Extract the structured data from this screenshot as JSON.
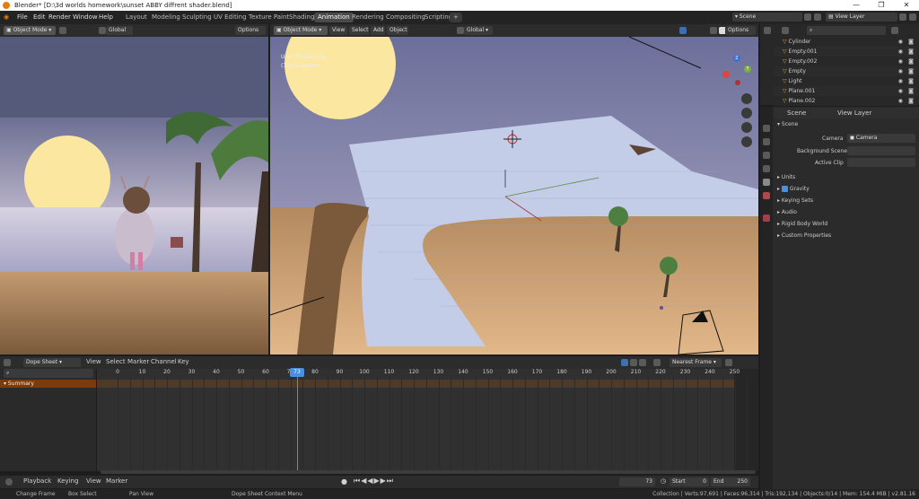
{
  "title": "Blender* [D:\\3d worlds homework\\sunset ABBY diffrent shader.blend]",
  "window_controls": [
    "—",
    "❐",
    "✕"
  ],
  "menu": {
    "file": "File",
    "edit": "Edit",
    "render": "Render",
    "window": "Window",
    "help": "Help"
  },
  "workspaces": [
    "Layout",
    "Modeling",
    "Sculpting",
    "UV Editing",
    "Texture Paint",
    "Shading",
    "Animation",
    "Rendering",
    "Compositing",
    "Scripting",
    "+"
  ],
  "scene": "Scene",
  "view_layer": "View Layer",
  "left_view": {
    "mode": "Object Mode",
    "transform": "Global",
    "options": "Options"
  },
  "main_view": {
    "mode": "Object Mode",
    "view": "View",
    "select": "Select",
    "add": "Add",
    "object": "Object",
    "transform": "Global",
    "options": "Options",
    "info_line1": "User Perspective",
    "info_line2": "(73) Collection"
  },
  "outliner": {
    "items": [
      "Cylinder",
      "Empty.001",
      "Empty.002",
      "Empty",
      "Light",
      "Plane.001",
      "Plane.002"
    ]
  },
  "properties": {
    "scene_tab": "Scene",
    "view_layer_tab": "View Layer",
    "section": "Scene",
    "camera_label": "Camera",
    "camera_value": "Camera",
    "background_label": "Background Scene",
    "clip_label": "Active Clip",
    "panels": [
      "Units",
      "Gravity",
      "Keying Sets",
      "Audio",
      "Rigid Body World",
      "Custom Properties"
    ]
  },
  "dopesheet": {
    "editor": "Dope Sheet",
    "view": "View",
    "select": "Select",
    "marker": "Marker",
    "channel": "Channel",
    "key": "Key",
    "snap": "Nearest Frame",
    "summary": "Summary",
    "current_frame": "73",
    "ticks": [
      "0",
      "10",
      "20",
      "30",
      "40",
      "50",
      "60",
      "70",
      "80",
      "90",
      "100",
      "110",
      "120",
      "130",
      "140",
      "150",
      "160",
      "170",
      "180",
      "190",
      "200",
      "210",
      "220",
      "230",
      "240",
      "250"
    ]
  },
  "timeline": {
    "playback": "Playback",
    "keying": "Keying",
    "view": "View",
    "marker": "Marker",
    "frame": "73",
    "start_label": "Start",
    "start": "0",
    "end_label": "End",
    "end": "250"
  },
  "statusbar": {
    "change_frame": "Change Frame",
    "box_select": "Box Select",
    "pan_view": "Pan View",
    "context_menu": "Dope Sheet Context Menu",
    "stats": "Collection | Verts:97,691 | Faces:96,314 | Tris:192,134 | Objects:0/14 | Mem: 154.4 MiB | v2.81.16"
  }
}
